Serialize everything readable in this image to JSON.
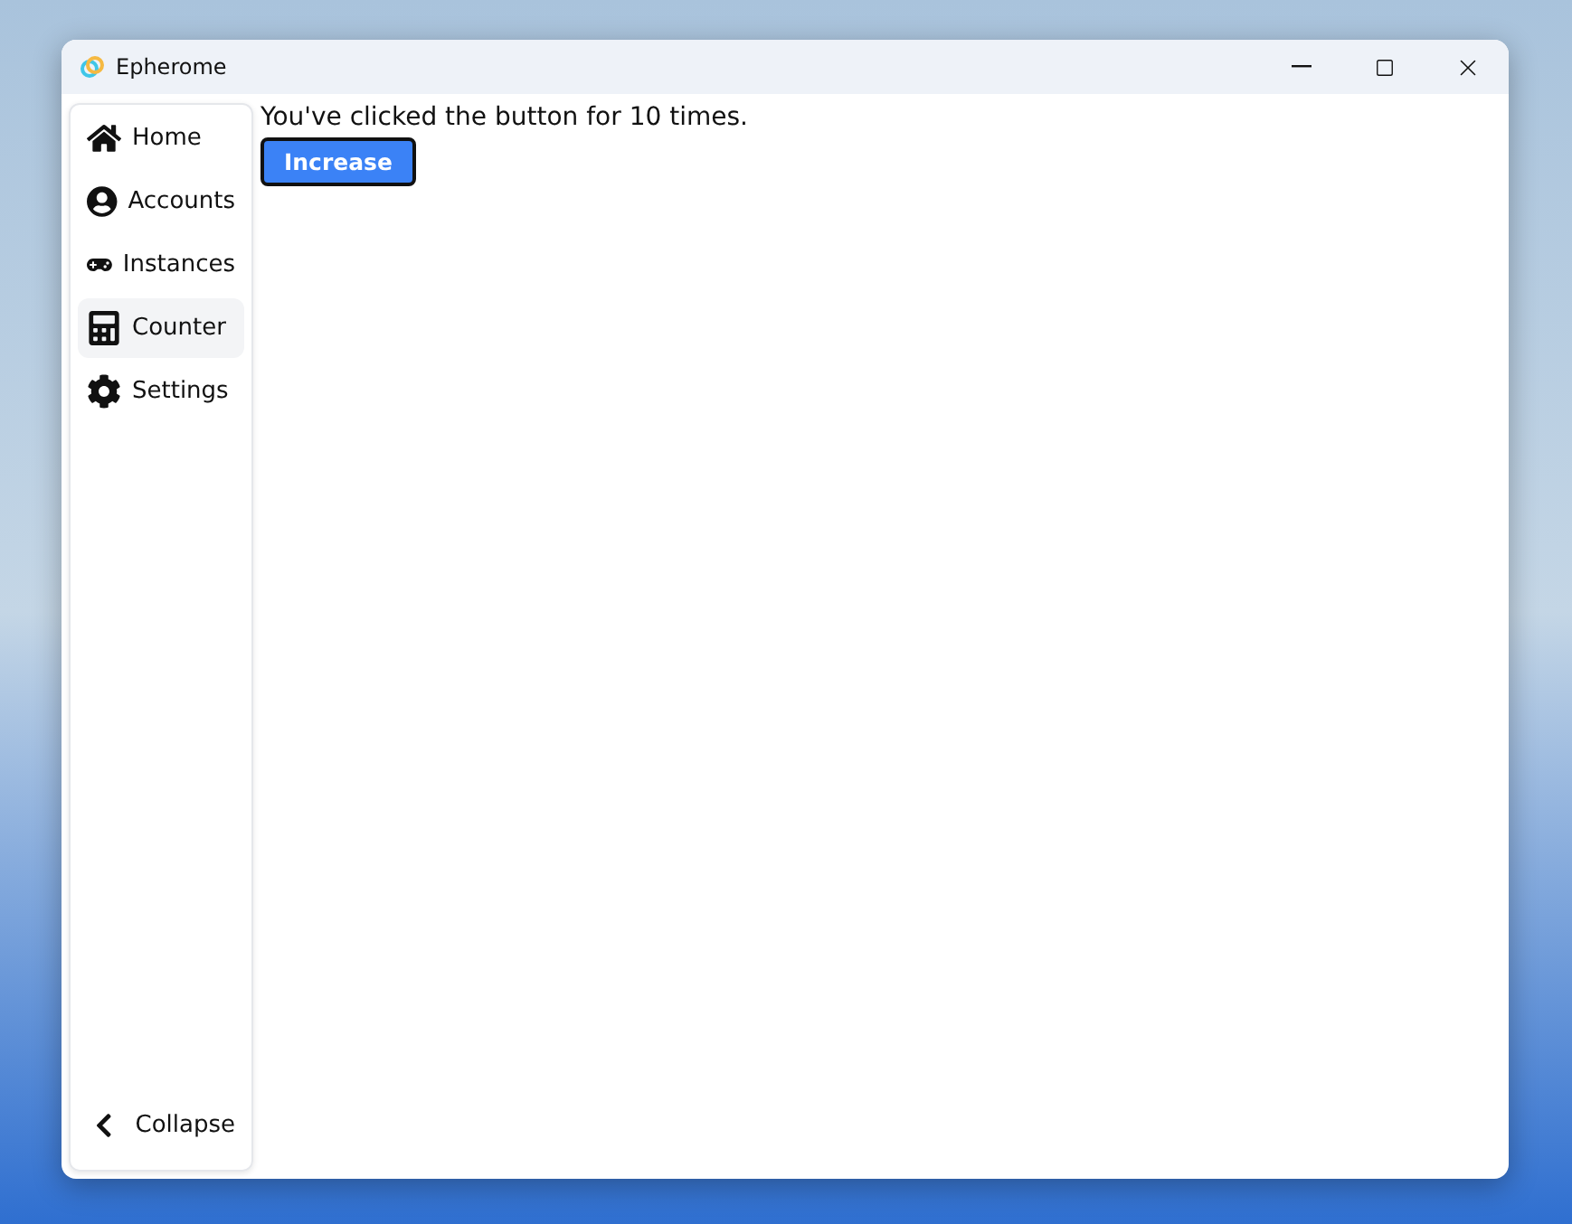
{
  "window": {
    "title": "Epherome"
  },
  "sidebar": {
    "items": [
      {
        "kind": "home",
        "label": "Home",
        "selected": false
      },
      {
        "kind": "accounts",
        "label": "Accounts",
        "selected": false
      },
      {
        "kind": "instances",
        "label": "Instances",
        "selected": false
      },
      {
        "kind": "counter",
        "label": "Counter",
        "selected": true
      },
      {
        "kind": "settings",
        "label": "Settings",
        "selected": false
      }
    ],
    "collapse": {
      "label": "Collapse"
    }
  },
  "content": {
    "message": "You've clicked the button for 10 times.",
    "button": "Increase"
  }
}
